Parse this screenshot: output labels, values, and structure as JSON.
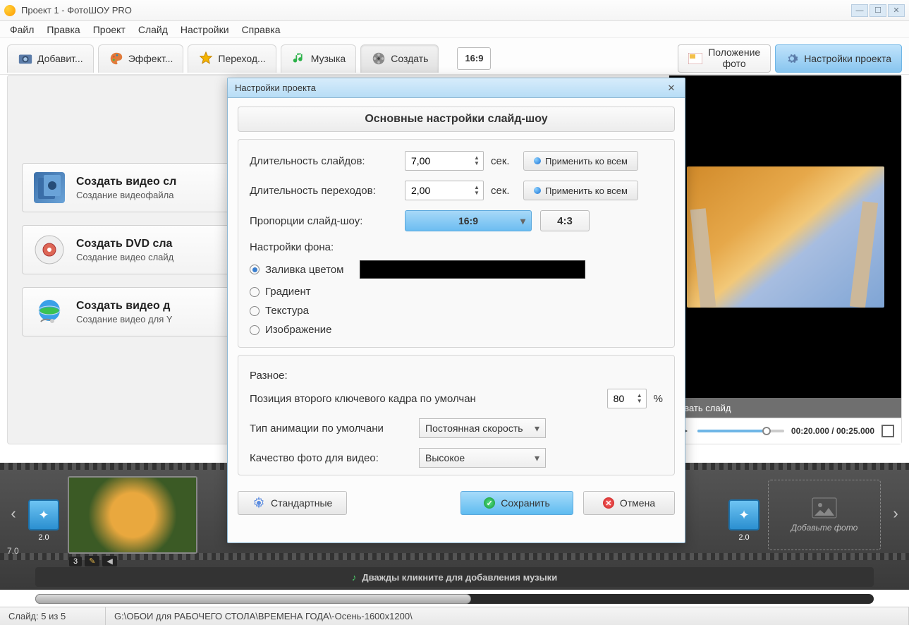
{
  "window": {
    "title": "Проект 1 - ФотоШОУ PRO"
  },
  "menu": {
    "file": "Файл",
    "edit": "Правка",
    "project": "Проект",
    "slide": "Слайд",
    "settings": "Настройки",
    "help": "Справка"
  },
  "tabs": {
    "add": "Добавит...",
    "effects": "Эффект...",
    "transitions": "Переход...",
    "music": "Музыка",
    "create": "Создать"
  },
  "topbar": {
    "aspect": "16:9",
    "photo_pos_line1": "Положение",
    "photo_pos_line2": "фото",
    "proj_settings": "Настройки проекта"
  },
  "cards": {
    "video": {
      "title": "Создать видео сл",
      "sub": "Создание видеофайла"
    },
    "dvd": {
      "title": "Создать DVD сла",
      "sub": "Создание видео слайд"
    },
    "web": {
      "title": "Создать видео д",
      "sub": "Создание видео для Y"
    }
  },
  "preview": {
    "edit": "овать слайд",
    "time": "00:20.000 / 00:25.000"
  },
  "timeline": {
    "dur_left": "7.0",
    "trans_a": "2.0",
    "slide_index": "3",
    "trans_b": "2.0",
    "add": "Добавьте фото",
    "music_hint": "Дважды кликните для добавления музыки"
  },
  "status": {
    "slide": "Слайд: 5 из 5",
    "path": "G:\\ОБОИ для РАБОЧЕГО СТОЛА\\ВРЕМЕНА ГОДА\\-Осень-1600x1200\\"
  },
  "dialog": {
    "title": "Настройки проекта",
    "heading": "Основные настройки слайд-шоу",
    "slide_dur_label": "Длительность слайдов:",
    "slide_dur_value": "7,00",
    "trans_dur_label": "Длительность переходов:",
    "trans_dur_value": "2,00",
    "sec": "сек.",
    "apply_all": "Применить ко всем",
    "aspect_label": "Пропорции слайд-шоу:",
    "aspect_169": "16:9",
    "aspect_43": "4:3",
    "bg_header": "Настройки фона:",
    "bg_fill": "Заливка цветом",
    "bg_gradient": "Градиент",
    "bg_texture": "Текстура",
    "bg_image": "Изображение",
    "misc_header": "Разное:",
    "keyframe_label": "Позиция второго ключевого кадра по умолчан",
    "keyframe_value": "80",
    "percent": "%",
    "anim_label": "Тип анимации по умолчани",
    "anim_value": "Постоянная скорость",
    "quality_label": "Качество фото для видео:",
    "quality_value": "Высокое",
    "defaults": "Стандартные",
    "save": "Сохранить",
    "cancel": "Отмена"
  }
}
